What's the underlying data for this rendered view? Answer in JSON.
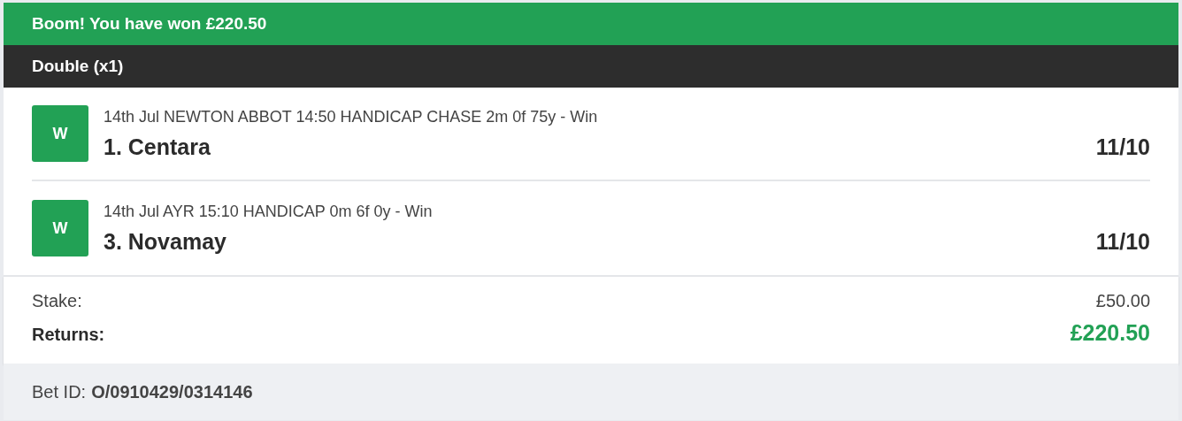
{
  "banner": {
    "text": "Boom! You have won £220.50"
  },
  "bet_type": "Double (x1)",
  "legs": [
    {
      "badge": "W",
      "event": "14th Jul NEWTON ABBOT 14:50 HANDICAP CHASE 2m 0f 75y - Win",
      "selection": "1. Centara",
      "odds": "11/10"
    },
    {
      "badge": "W",
      "event": "14th Jul AYR 15:10 HANDICAP 0m 6f 0y - Win",
      "selection": "3. Novamay",
      "odds": "11/10"
    }
  ],
  "summary": [
    {
      "kind": "plain",
      "label": "Stake:",
      "value": "£50.00"
    },
    {
      "kind": "returns",
      "label": "Returns:",
      "value": "£220.50"
    }
  ],
  "footer": {
    "label": "Bet ID:",
    "value": "O/0910429/0314146"
  }
}
